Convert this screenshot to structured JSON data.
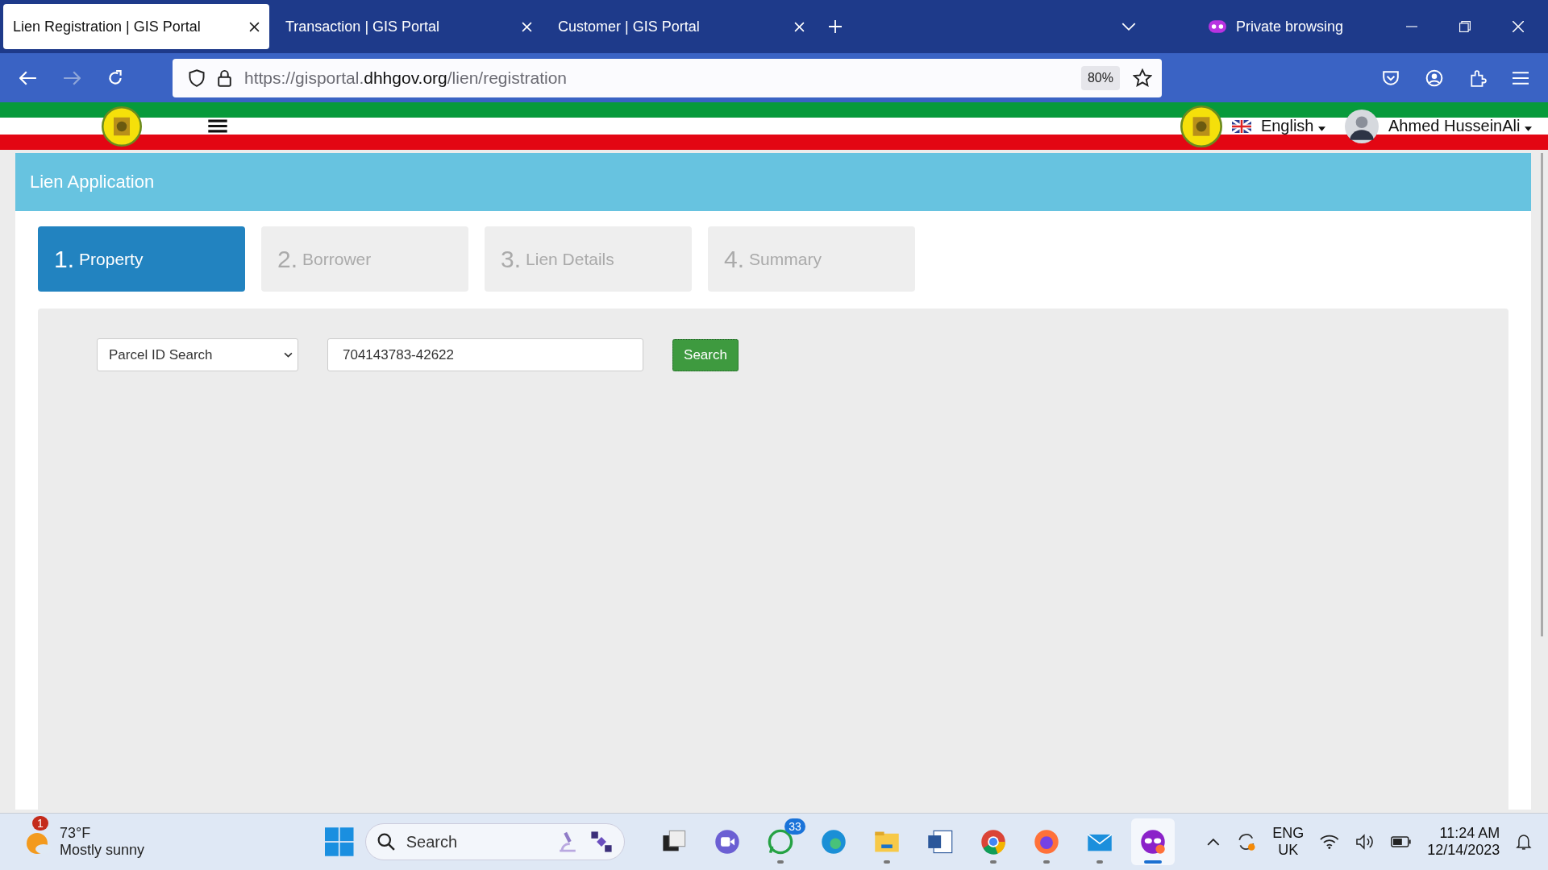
{
  "browser": {
    "tabs": [
      {
        "title": "Lien Registration | GIS Portal",
        "selected": true
      },
      {
        "title": "Transaction | GIS Portal",
        "selected": false
      },
      {
        "title": "Customer | GIS Portal",
        "selected": false
      }
    ],
    "private_label": "Private browsing",
    "url": {
      "prefix": "https://gisportal.",
      "domain": "dhhgov.org",
      "path": "/lien/registration"
    },
    "zoom": "80%"
  },
  "header": {
    "language": "English",
    "user": "Ahmed HusseinAli"
  },
  "page_title": "Lien Application",
  "steps": [
    {
      "number": "1.",
      "label": "Property",
      "selected": true
    },
    {
      "number": "2.",
      "label": "Borrower",
      "selected": false
    },
    {
      "number": "3.",
      "label": "Lien Details",
      "selected": false
    },
    {
      "number": "4.",
      "label": "Summary",
      "selected": false
    }
  ],
  "search": {
    "mode": "Parcel ID Search",
    "value": "704143783-42622",
    "button": "Search"
  },
  "taskbar": {
    "weather": {
      "temp": "73°F",
      "condition": "Mostly sunny",
      "badge": "1"
    },
    "search_placeholder": "Search",
    "apps": [
      {
        "kind": "taskview",
        "running": false,
        "selected": false
      },
      {
        "kind": "meet",
        "running": false,
        "selected": false
      },
      {
        "kind": "whatsapp",
        "running": true,
        "selected": false,
        "badge": "33"
      },
      {
        "kind": "edge",
        "running": false,
        "selected": false
      },
      {
        "kind": "files",
        "running": true,
        "selected": false
      },
      {
        "kind": "word",
        "running": false,
        "selected": false
      },
      {
        "kind": "chrome",
        "running": true,
        "selected": false
      },
      {
        "kind": "firefox",
        "running": true,
        "selected": false
      },
      {
        "kind": "mail",
        "running": true,
        "selected": false
      },
      {
        "kind": "private",
        "running": true,
        "selected": true
      }
    ],
    "lang": "ENG",
    "region": "UK",
    "time": "11:24 AM",
    "date": "12/14/2023"
  }
}
